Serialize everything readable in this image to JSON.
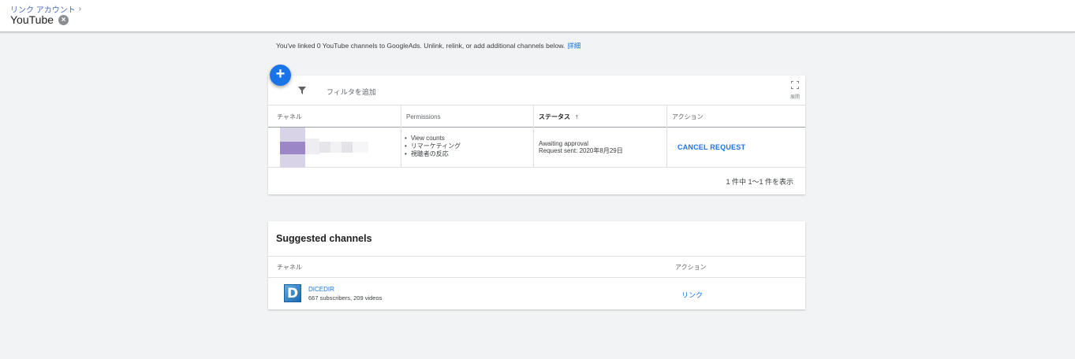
{
  "header": {
    "breadcrumb": "リンク アカウント",
    "breadcrumb_chevron": "›",
    "title": "YouTube",
    "close_glyph": "×"
  },
  "info": {
    "text": "You've linked 0 YouTube channels to GoogleAds. Unlink, relink, or add additional channels below.",
    "link": "詳細"
  },
  "toolbar": {
    "add_glyph": "+",
    "filter_label": "フィルタを追加",
    "expand_label": "展開"
  },
  "table": {
    "columns": [
      "チャネル",
      "Permissions",
      "ステータス",
      "アクション"
    ],
    "sort_arrow": "↑",
    "rows": [
      {
        "permissions": [
          "View counts",
          "リマーケティング",
          "視聴者の反応"
        ],
        "status_line1": "Awaiting approval",
        "status_line2": "Request sent: 2020年8月29日",
        "action": "CANCEL REQUEST"
      }
    ],
    "pagination": "1 件中 1～1 件を表示"
  },
  "suggested": {
    "title": "Suggested channels",
    "columns": [
      "チャネル",
      "アクション"
    ],
    "rows": [
      {
        "logo_letter": "D",
        "name": "DICEDIR",
        "stats": "667 subscribers, 209 videos",
        "action": "リンク"
      }
    ]
  },
  "colors": {
    "accent": "#1a73e8",
    "background": "#f1f3f4",
    "blur_purple": "#9b86c6"
  },
  "icons": {
    "filter": "filter-icon",
    "expand": "fullscreen-icon",
    "add": "plus-icon",
    "close": "close-circle-icon"
  }
}
